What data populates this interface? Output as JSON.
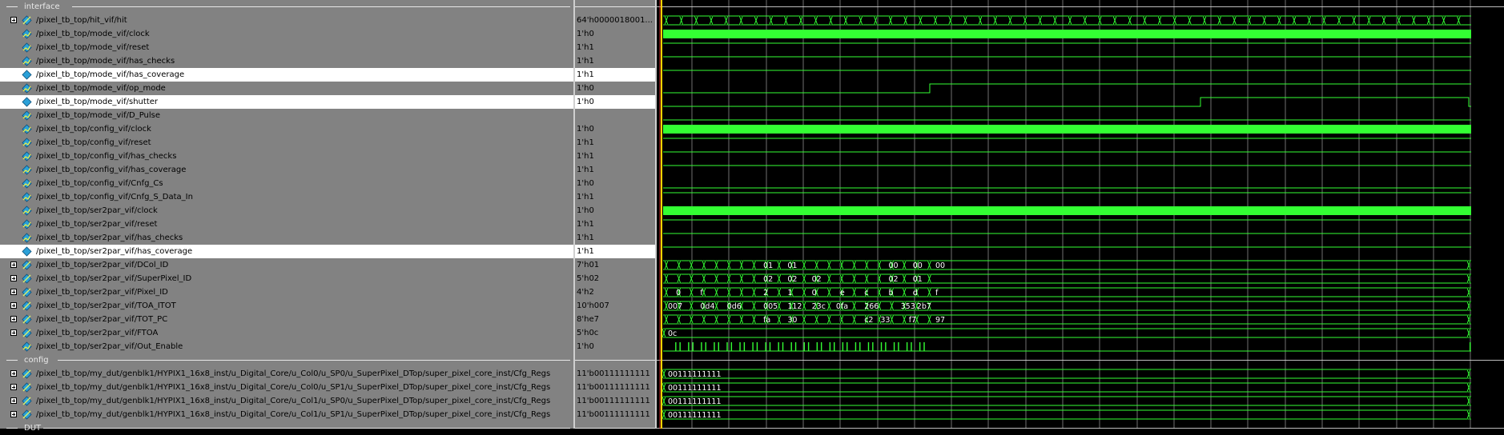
{
  "colors": {
    "signal": "#33ff33",
    "cursor": "#ffd400",
    "grid": "#d8d8d8",
    "text": "#ffffff",
    "panel": "#828282"
  },
  "groups": [
    {
      "label": "interface",
      "row": 0
    },
    {
      "label": "config",
      "row": 26
    },
    {
      "label": "DUT",
      "row": 31
    }
  ],
  "signals": [
    {
      "row": 1,
      "name": "/pixel_tb_top/hit_vif/hit",
      "value": "64'h0000018001...",
      "expandable": true,
      "icon": "bus-icon",
      "sel": false,
      "kind": "bus",
      "fill": "hex",
      "labels": []
    },
    {
      "row": 2,
      "name": "/pixel_tb_top/mode_vif/clock",
      "value": "1'h0",
      "expandable": false,
      "icon": "wire-icon",
      "sel": false,
      "kind": "clock",
      "level": 1
    },
    {
      "row": 3,
      "name": "/pixel_tb_top/mode_vif/reset",
      "value": "1'h1",
      "expandable": false,
      "icon": "wire-icon",
      "sel": false,
      "kind": "level",
      "level": 1
    },
    {
      "row": 4,
      "name": "/pixel_tb_top/mode_vif/has_checks",
      "value": "1'h1",
      "expandable": false,
      "icon": "wire-icon",
      "sel": false,
      "kind": "level",
      "level": 1
    },
    {
      "row": 5,
      "name": "/pixel_tb_top/mode_vif/has_coverage",
      "value": "1'h1",
      "expandable": false,
      "icon": "diamond-icon",
      "sel": true,
      "kind": "level",
      "level": 1
    },
    {
      "row": 6,
      "name": "/pixel_tb_top/mode_vif/op_mode",
      "value": "1'h0",
      "expandable": false,
      "icon": "wire-icon",
      "sel": false,
      "kind": "step",
      "level": 0,
      "edges": [
        0.33
      ]
    },
    {
      "row": 7,
      "name": "/pixel_tb_top/mode_vif/shutter",
      "value": "1'h0",
      "expandable": false,
      "icon": "diamond-icon",
      "sel": true,
      "kind": "step",
      "level": 0,
      "edges": [
        0.665,
        0.997
      ]
    },
    {
      "row": 8,
      "name": "/pixel_tb_top/mode_vif/D_Pulse",
      "value": "",
      "expandable": false,
      "icon": "wire-icon",
      "sel": false,
      "kind": "level",
      "level": 0
    },
    {
      "row": 9,
      "name": "/pixel_tb_top/config_vif/clock",
      "value": "1'h0",
      "expandable": false,
      "icon": "wire-icon",
      "sel": false,
      "kind": "clock",
      "level": 1
    },
    {
      "row": 10,
      "name": "/pixel_tb_top/config_vif/reset",
      "value": "1'h1",
      "expandable": false,
      "icon": "wire-icon",
      "sel": false,
      "kind": "level",
      "level": 1
    },
    {
      "row": 11,
      "name": "/pixel_tb_top/config_vif/has_checks",
      "value": "1'h1",
      "expandable": false,
      "icon": "wire-icon",
      "sel": false,
      "kind": "level",
      "level": 1
    },
    {
      "row": 12,
      "name": "/pixel_tb_top/config_vif/has_coverage",
      "value": "1'h1",
      "expandable": false,
      "icon": "wire-icon",
      "sel": false,
      "kind": "level",
      "level": 1
    },
    {
      "row": 13,
      "name": "/pixel_tb_top/config_vif/Cnfg_Cs",
      "value": "1'h0",
      "expandable": false,
      "icon": "wire-icon",
      "sel": false,
      "kind": "level",
      "level": 0
    },
    {
      "row": 14,
      "name": "/pixel_tb_top/config_vif/Cnfg_S_Data_In",
      "value": "1'h1",
      "expandable": false,
      "icon": "wire-icon",
      "sel": false,
      "kind": "level",
      "level": 1
    },
    {
      "row": 15,
      "name": "/pixel_tb_top/ser2par_vif/clock",
      "value": "1'h0",
      "expandable": false,
      "icon": "wire-icon",
      "sel": false,
      "kind": "clock",
      "level": 1
    },
    {
      "row": 16,
      "name": "/pixel_tb_top/ser2par_vif/reset",
      "value": "1'h1",
      "expandable": false,
      "icon": "wire-icon",
      "sel": false,
      "kind": "level",
      "level": 1
    },
    {
      "row": 17,
      "name": "/pixel_tb_top/ser2par_vif/has_checks",
      "value": "1'h1",
      "expandable": false,
      "icon": "wire-icon",
      "sel": false,
      "kind": "level",
      "level": 1
    },
    {
      "row": 18,
      "name": "/pixel_tb_top/ser2par_vif/has_coverage",
      "value": "1'h1",
      "expandable": false,
      "icon": "diamond-icon",
      "sel": true,
      "kind": "level",
      "level": 1
    },
    {
      "row": 19,
      "name": "/pixel_tb_top/ser2par_vif/DCol_ID",
      "value": "7'h01",
      "expandable": true,
      "icon": "bus-icon",
      "sel": false,
      "kind": "bus",
      "labels": [
        [
          "01",
          0.12
        ],
        [
          "01",
          0.15
        ],
        [
          "00",
          0.275
        ],
        [
          "00",
          0.305
        ],
        [
          "00",
          0.333
        ]
      ]
    },
    {
      "row": 20,
      "name": "/pixel_tb_top/ser2par_vif/SuperPixel_ID",
      "value": "5'h02",
      "expandable": true,
      "icon": "bus-icon",
      "sel": false,
      "kind": "bus",
      "labels": [
        [
          "02",
          0.12
        ],
        [
          "02",
          0.15
        ],
        [
          "02",
          0.18
        ],
        [
          "02",
          0.275
        ],
        [
          "01",
          0.305
        ]
      ]
    },
    {
      "row": 21,
      "name": "/pixel_tb_top/ser2par_vif/Pixel_ID",
      "value": "4'h2",
      "expandable": true,
      "icon": "bus-icon",
      "sel": false,
      "kind": "bus",
      "labels": [
        [
          "0",
          0.012
        ],
        [
          "f",
          0.042
        ],
        [
          "2",
          0.12
        ],
        [
          "1",
          0.15
        ],
        [
          "0",
          0.18
        ],
        [
          "e",
          0.215
        ],
        [
          "c",
          0.245
        ],
        [
          "b",
          0.275
        ],
        [
          "d",
          0.305
        ],
        [
          "f",
          0.333
        ]
      ]
    },
    {
      "row": 22,
      "name": "/pixel_tb_top/ser2par_vif/TOA_ITOT",
      "value": "10'h007",
      "expandable": true,
      "icon": "bus-icon",
      "sel": false,
      "kind": "bus",
      "labels": [
        [
          "007",
          0.002
        ],
        [
          "0d4",
          0.042
        ],
        [
          "0d6",
          0.075
        ],
        [
          "005",
          0.12
        ],
        [
          "112",
          0.15
        ],
        [
          "23c",
          0.18
        ],
        [
          "0fa",
          0.21
        ],
        [
          "266",
          0.245
        ],
        [
          "353",
          0.29
        ],
        [
          "2b7",
          0.31
        ]
      ]
    },
    {
      "row": 23,
      "name": "/pixel_tb_top/ser2par_vif/TOT_PC",
      "value": "8'he7",
      "expandable": true,
      "icon": "bus-icon",
      "sel": false,
      "kind": "bus",
      "labels": [
        [
          "fa",
          0.12
        ],
        [
          "30",
          0.15
        ],
        [
          "c2",
          0.245
        ],
        [
          "33",
          0.265
        ],
        [
          "f7",
          0.3
        ],
        [
          "97",
          0.333
        ]
      ]
    },
    {
      "row": 24,
      "name": "/pixel_tb_top/ser2par_vif/FTOA",
      "value": "5'h0c",
      "expandable": true,
      "icon": "bus-icon",
      "sel": false,
      "kind": "bus",
      "labels": [
        [
          "0c",
          0.002
        ]
      ]
    },
    {
      "row": 25,
      "name": "/pixel_tb_top/ser2par_vif/Out_Enable",
      "value": "1'h0",
      "expandable": false,
      "icon": "wire-icon",
      "sel": false,
      "kind": "pulses",
      "level": 0
    },
    {
      "row": 27,
      "name": "/pixel_tb_top/my_dut/genblk1/HYPIX1_16x8_inst/u_Digital_Core/u_Col0/u_SP0/u_SuperPixel_DTop/super_pixel_core_inst/Cfg_Regs",
      "value": "11'b00111111111",
      "expandable": true,
      "icon": "bus-icon",
      "sel": false,
      "kind": "bus",
      "labels": [
        [
          "00111111111",
          0.002
        ]
      ]
    },
    {
      "row": 28,
      "name": "/pixel_tb_top/my_dut/genblk1/HYPIX1_16x8_inst/u_Digital_Core/u_Col0/u_SP1/u_SuperPixel_DTop/super_pixel_core_inst/Cfg_Regs",
      "value": "11'b00111111111",
      "expandable": true,
      "icon": "bus-icon",
      "sel": false,
      "kind": "bus",
      "labels": [
        [
          "00111111111",
          0.002
        ]
      ]
    },
    {
      "row": 29,
      "name": "/pixel_tb_top/my_dut/genblk1/HYPIX1_16x8_inst/u_Digital_Core/u_Col1/u_SP0/u_SuperPixel_DTop/super_pixel_core_inst/Cfg_Regs",
      "value": "11'b00111111111",
      "expandable": true,
      "icon": "bus-icon",
      "sel": false,
      "kind": "bus",
      "labels": [
        [
          "00111111111",
          0.002
        ]
      ]
    },
    {
      "row": 30,
      "name": "/pixel_tb_top/my_dut/genblk1/HYPIX1_16x8_inst/u_Digital_Core/u_Col1/u_SP1/u_SuperPixel_DTop/super_pixel_core_inst/Cfg_Regs",
      "value": "11'b00111111111",
      "expandable": true,
      "icon": "bus-icon",
      "sel": false,
      "kind": "bus",
      "labels": [
        [
          "00111111111",
          0.002
        ]
      ]
    }
  ]
}
